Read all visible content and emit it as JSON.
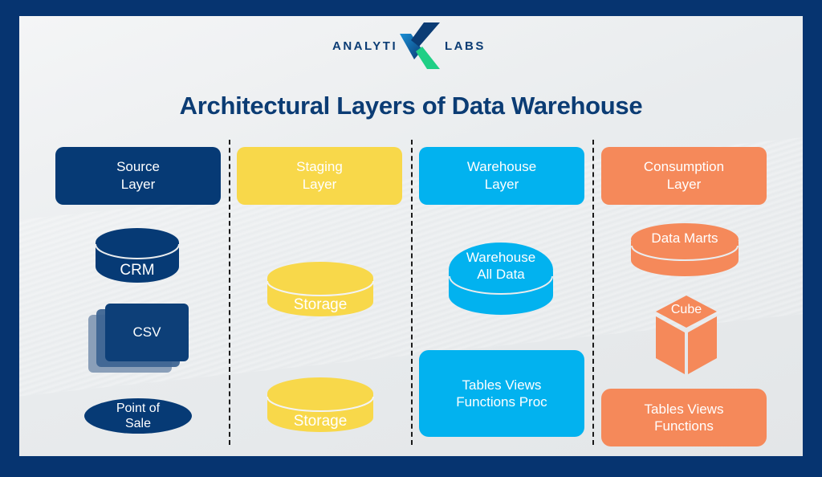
{
  "logo": {
    "left_text": "ANALYTI",
    "right_text": "LABS"
  },
  "title": "Architectural Layers of Data Warehouse",
  "colors": {
    "frame": "#063470",
    "source": "#063a75",
    "staging": "#f8d84a",
    "warehouse": "#02b2ef",
    "consumption": "#f5895a",
    "title": "#0b3c74"
  },
  "layers": [
    {
      "header": "Source\nLayer",
      "items": [
        {
          "type": "cylinder",
          "label": "CRM"
        },
        {
          "type": "stacked-files",
          "label": "CSV"
        },
        {
          "type": "ellipse",
          "label": "Point of\nSale"
        }
      ]
    },
    {
      "header": "Staging\nLayer",
      "items": [
        {
          "type": "cylinder",
          "label": "Storage"
        },
        {
          "type": "cylinder",
          "label": "Storage"
        }
      ]
    },
    {
      "header": "Warehouse\nLayer",
      "items": [
        {
          "type": "cylinder",
          "label": "Warehouse\nAll Data"
        },
        {
          "type": "box",
          "label": "Tables Views\nFunctions Proc"
        }
      ]
    },
    {
      "header": "Consumption\nLayer",
      "items": [
        {
          "type": "cylinder",
          "label": "Data Marts"
        },
        {
          "type": "cube",
          "label": "Cube"
        },
        {
          "type": "box",
          "label": "Tables Views\nFunctions"
        }
      ]
    }
  ]
}
